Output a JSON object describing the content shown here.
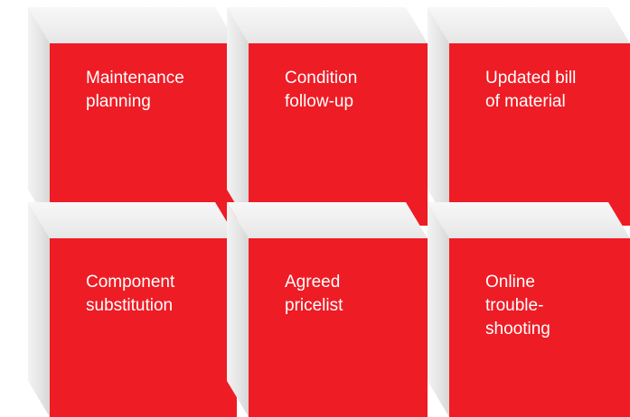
{
  "colors": {
    "tile_red": "#ee1c25",
    "text": "#ffffff",
    "cube_grey": "#e6e6e6"
  },
  "tiles": [
    {
      "label": "Maintenance\nplanning"
    },
    {
      "label": "Condition\nfollow-up"
    },
    {
      "label": "Updated bill\nof material"
    },
    {
      "label": "Component\nsubstitution"
    },
    {
      "label": "Agreed\npricelist"
    },
    {
      "label": "Online\ntrouble-\nshooting"
    }
  ]
}
